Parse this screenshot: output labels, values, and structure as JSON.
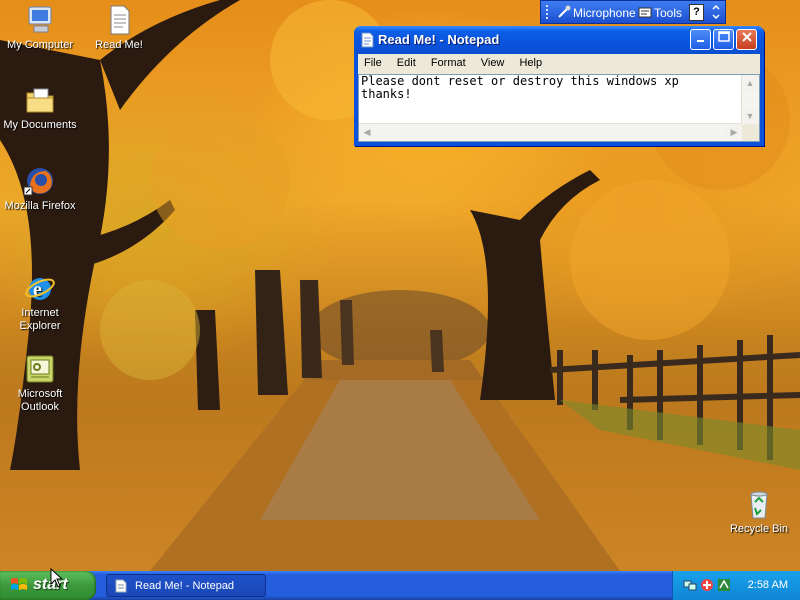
{
  "desktop": {
    "icons": [
      {
        "label": "My Computer",
        "icon": "my-computer-icon"
      },
      {
        "label": "Read Me!",
        "icon": "text-document-icon"
      },
      {
        "label": "My Documents",
        "icon": "my-documents-icon"
      },
      {
        "label": "Mozilla Firefox",
        "icon": "firefox-icon"
      },
      {
        "label": "Internet\nExplorer",
        "icon": "internet-explorer-icon"
      },
      {
        "label": "Microsoft\nOutlook",
        "icon": "outlook-icon"
      },
      {
        "label": "Recycle Bin",
        "icon": "recycle-bin-icon"
      }
    ]
  },
  "language_bar": {
    "microphone_label": "Microphone",
    "tools_label": "Tools",
    "help_label": "?"
  },
  "notepad": {
    "title": "Read Me! - Notepad",
    "menu": [
      "File",
      "Edit",
      "Format",
      "View",
      "Help"
    ],
    "text_line1": "Please dont reset or destroy this windows xp",
    "text_line2": "thanks!"
  },
  "taskbar": {
    "start_label": "start",
    "task_button_label": "Read Me! - Notepad",
    "clock": "2:58 AM"
  },
  "colors": {
    "taskbar_blue": "#245edc",
    "start_green": "#3c9a3c",
    "tray_blue": "#0f86d6",
    "close_red": "#c6401e"
  }
}
